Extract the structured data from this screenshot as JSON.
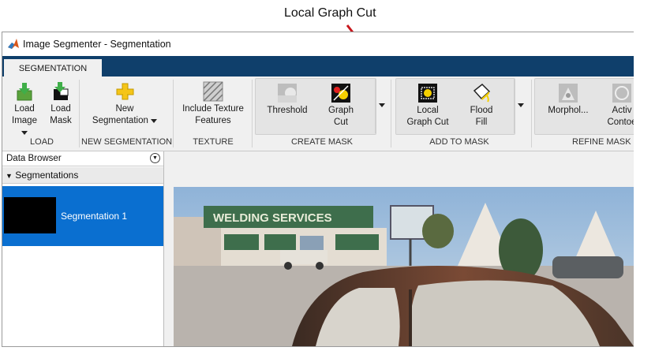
{
  "annotation": {
    "text": "Local Graph Cut"
  },
  "window": {
    "title": "Image Segmenter - Segmentation"
  },
  "tabs": [
    {
      "label": "SEGMENTATION"
    }
  ],
  "ribbon": {
    "load": {
      "load_image": [
        "Load",
        "Image"
      ],
      "load_mask": [
        "Load",
        "Mask"
      ],
      "section": "LOAD"
    },
    "new_segmentation": {
      "label": [
        "New",
        "Segmentation"
      ],
      "section": "NEW SEGMENTATION"
    },
    "texture": {
      "label": [
        "Include Texture",
        "Features"
      ],
      "section": "TEXTURE"
    },
    "create_mask": {
      "threshold": "Threshold",
      "graph_cut": [
        "Graph",
        "Cut"
      ],
      "section": "CREATE MASK"
    },
    "add_to_mask": {
      "local_graph_cut": [
        "Local",
        "Graph Cut"
      ],
      "flood_fill": [
        "Flood",
        "Fill"
      ],
      "section": "ADD TO MASK"
    },
    "refine_mask": {
      "morphology": "Morphol...",
      "active_contours": [
        "Activ",
        "Contoe"
      ],
      "section": "REFINE MASK"
    }
  },
  "data_browser": {
    "title": "Data Browser",
    "segmentations_header": "Segmentations",
    "items": [
      {
        "label": "Segmentation 1"
      }
    ]
  },
  "photo": {
    "sign_text": "WELDING SERVICES"
  },
  "colors": {
    "accent_blue": "#0a6fd0",
    "tab_strip": "#0f3f6b",
    "arrow": "#c8171d"
  }
}
